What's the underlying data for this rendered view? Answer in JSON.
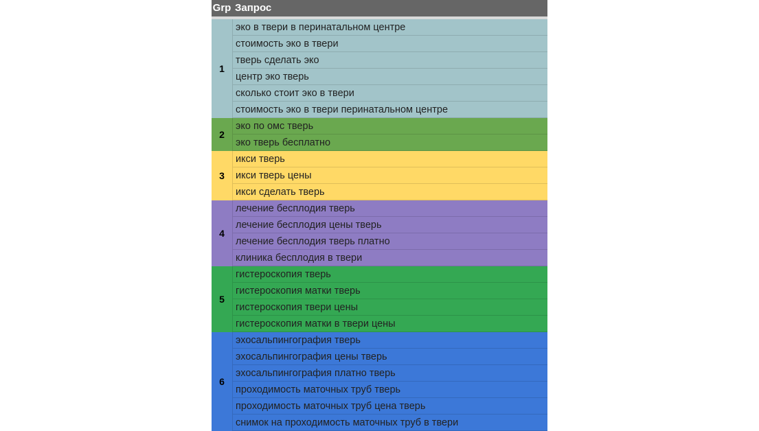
{
  "header": {
    "group_label": "Grp",
    "query_label": "Запрос"
  },
  "groups": [
    {
      "id": "1",
      "color": "#a2c4c9",
      "queries": [
        "эко в твери в перинатальном центре",
        "стоимость эко в твери",
        "тверь сделать эко",
        "центр эко тверь",
        "сколько стоит эко в твери",
        "стоимость эко в твери перинатальном центре"
      ]
    },
    {
      "id": "2",
      "color": "#6aa84f",
      "queries": [
        "эко по омс тверь",
        "эко тверь бесплатно"
      ]
    },
    {
      "id": "3",
      "color": "#ffd966",
      "queries": [
        "икси тверь",
        "икси тверь цены",
        "икси сделать тверь"
      ]
    },
    {
      "id": "4",
      "color": "#8e7cc3",
      "queries": [
        "лечение бесплодия тверь",
        "лечение бесплодия цены тверь",
        "лечение бесплодия тверь платно",
        "клиника бесплодия в твери"
      ]
    },
    {
      "id": "5",
      "color": "#34a853",
      "queries": [
        "гистероскопия тверь",
        "гистероскопия матки тверь",
        "гистероскопия твери цены",
        "гистероскопия матки в твери цены"
      ]
    },
    {
      "id": "6",
      "color": "#3c78d8",
      "queries": [
        "эхосальпингография тверь",
        "эхосальпингография цены тверь",
        "эхосальпингография платно тверь",
        "проходимость маточных труб тверь",
        "проходимость маточных труб цена тверь",
        "снимок на проходимость маточных труб в твери"
      ]
    }
  ]
}
